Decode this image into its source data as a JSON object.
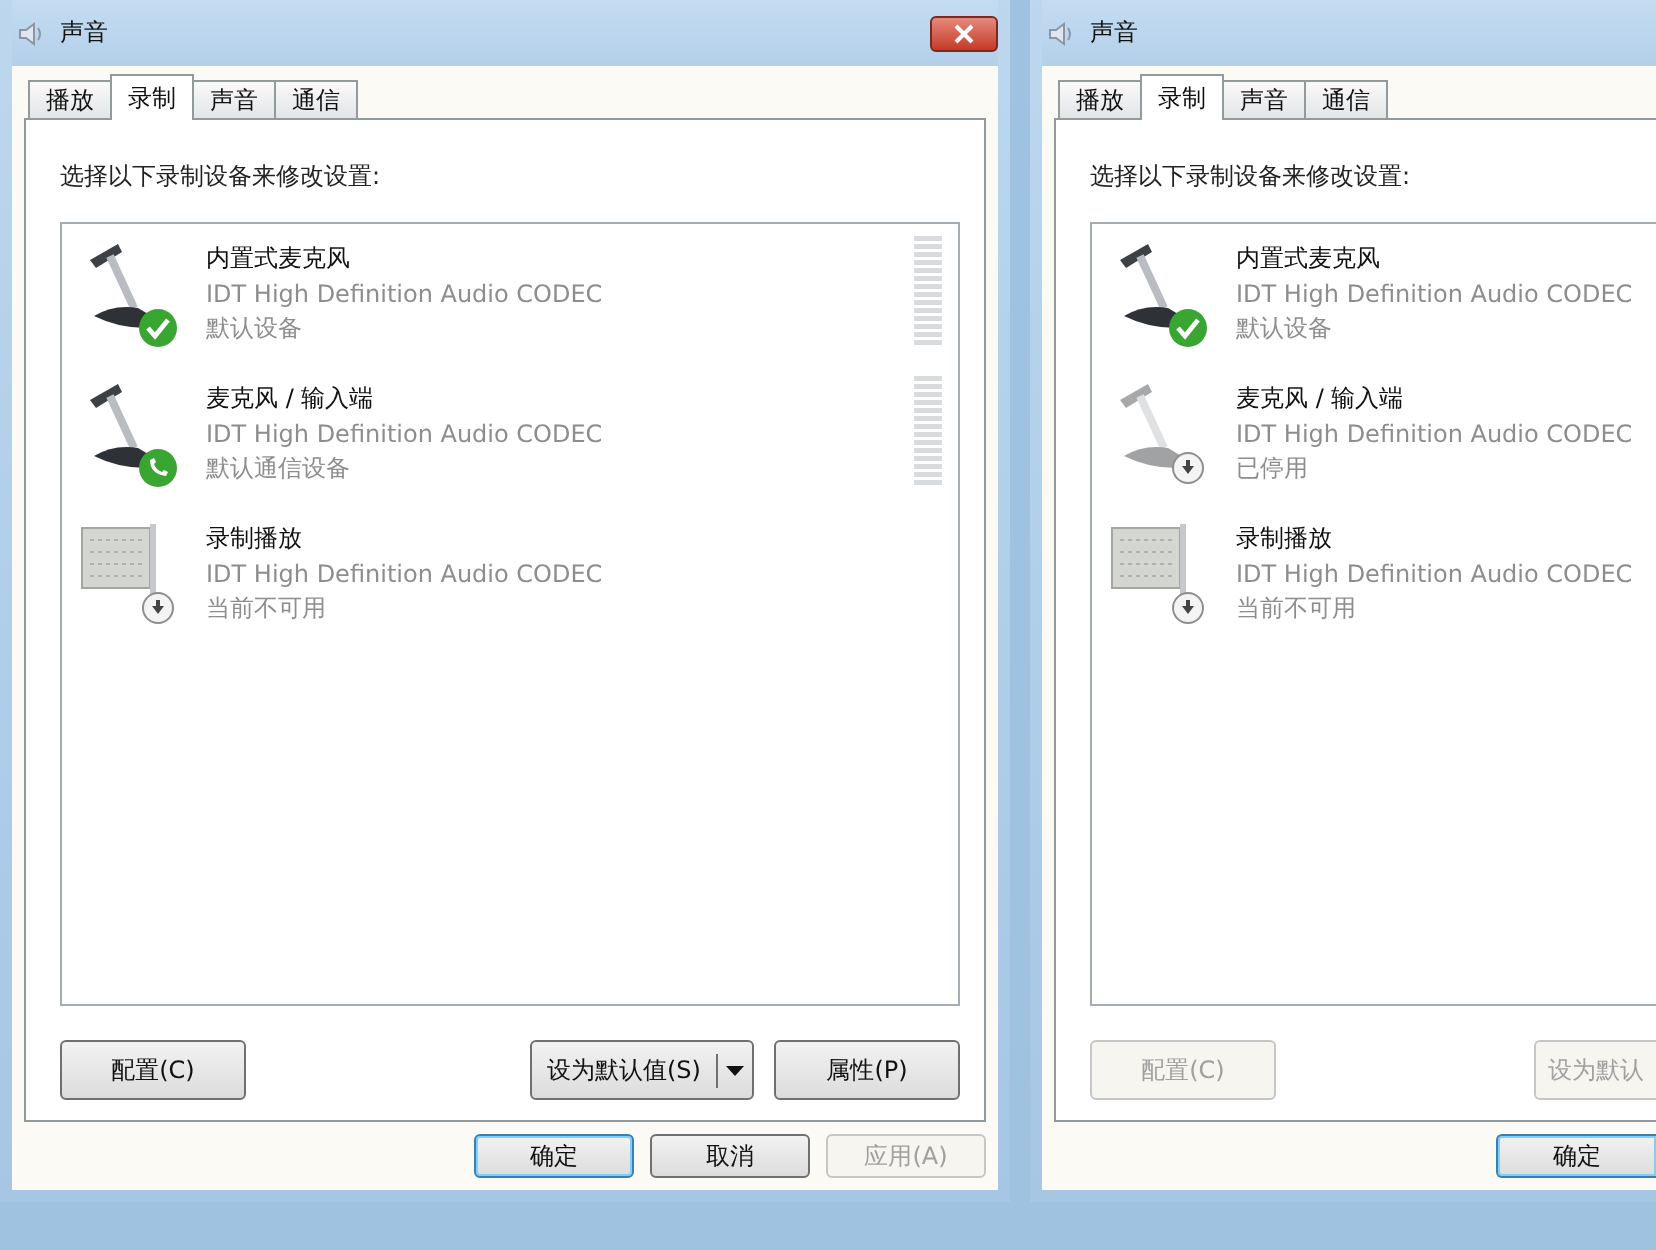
{
  "dialogs": [
    {
      "title": "声音",
      "close_button": true,
      "tabs": [
        {
          "label": "播放",
          "selected": false
        },
        {
          "label": "录制",
          "selected": true
        },
        {
          "label": "声音",
          "selected": false
        },
        {
          "label": "通信",
          "selected": false
        }
      ],
      "instruction": "选择以下录制设备来修改设置:",
      "devices": [
        {
          "kind": "microphone",
          "default": true,
          "default_communication": false,
          "active": true,
          "disabled": false,
          "meter": true,
          "name": "内置式麦克风",
          "driver": "IDT High Definition Audio CODEC",
          "status": "默认设备"
        },
        {
          "kind": "microphone",
          "default": false,
          "default_communication": true,
          "active": true,
          "disabled": false,
          "meter": true,
          "name": "麦克风 / 输入端",
          "driver": "IDT High Definition Audio CODEC",
          "status": "默认通信设备"
        },
        {
          "kind": "sound_card",
          "default": false,
          "default_communication": false,
          "active": false,
          "disabled": false,
          "meter": false,
          "name": "录制播放",
          "driver": "IDT High Definition Audio CODEC",
          "status": "当前不可用"
        }
      ],
      "panel_buttons": [
        {
          "kind": "plain",
          "label": "配置(C)",
          "disabled": false
        },
        {
          "kind": "split",
          "label": "设为默认值(S)",
          "disabled": false
        },
        {
          "kind": "plain",
          "label": "属性(P)",
          "disabled": false
        }
      ],
      "buttons": [
        {
          "label": "确定",
          "focused": true,
          "disabled": false
        },
        {
          "label": "取消",
          "focused": false,
          "disabled": false
        },
        {
          "label": "应用(A)",
          "focused": false,
          "disabled": true
        }
      ]
    },
    {
      "title": "声音",
      "close_button": false,
      "tabs": [
        {
          "label": "播放",
          "selected": false
        },
        {
          "label": "录制",
          "selected": true
        },
        {
          "label": "声音",
          "selected": false
        },
        {
          "label": "通信",
          "selected": false
        }
      ],
      "instruction": "选择以下录制设备来修改设置:",
      "devices": [
        {
          "kind": "microphone",
          "default": true,
          "default_communication": false,
          "active": true,
          "disabled": false,
          "name": "内置式麦克风",
          "driver": "IDT High Definition Audio CODEC",
          "status": "默认设备"
        },
        {
          "kind": "microphone",
          "default": false,
          "default_communication": false,
          "active": false,
          "disabled": true,
          "name": "麦克风 / 输入端",
          "driver": "IDT High Definition Audio CODEC",
          "status": "已停用"
        },
        {
          "kind": "sound_card",
          "default": false,
          "default_communication": false,
          "active": false,
          "disabled": false,
          "name": "录制播放",
          "driver": "IDT High Definition Audio CODEC",
          "status": "当前不可用"
        }
      ],
      "panel_buttons": [
        {
          "kind": "plain",
          "label": "配置(C)",
          "disabled": true
        },
        {
          "kind": "plain",
          "label": "设为默认",
          "disabled": true
        }
      ],
      "buttons": [
        {
          "label": "确定",
          "focused": true,
          "disabled": false
        }
      ]
    }
  ]
}
